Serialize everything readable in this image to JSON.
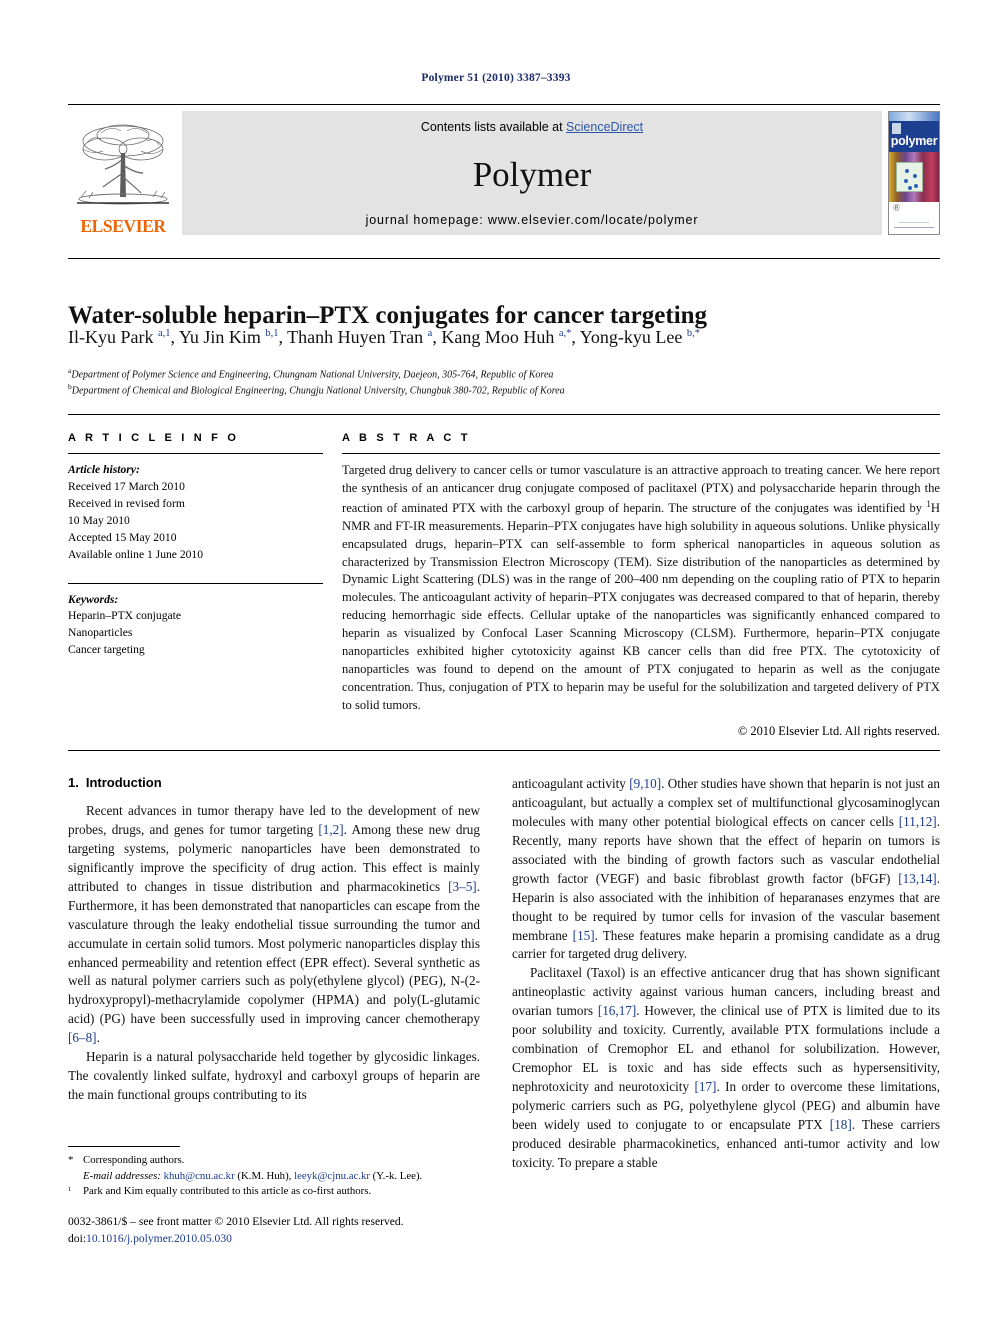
{
  "running_head": "Polymer 51 (2010) 3387–3393",
  "journal_header": {
    "contents_prefix": "Contents lists available at ",
    "sciencedirect": "ScienceDirect",
    "journal_name": "Polymer",
    "homepage": "journal homepage: www.elsevier.com/locate/polymer",
    "publisher_logo_text": "ELSEVIER",
    "cover_title": "polymer",
    "accent_color": "#2b57a8",
    "elsevier_orange": "#ec6607",
    "cover_blue": "#1c3f8f"
  },
  "article": {
    "title": "Water-soluble heparin–PTX conjugates for cancer targeting",
    "authors_html": "Il-Kyu Park <sup>a,1</sup>, Yu Jin Kim <sup>b,1</sup>, Thanh Huyen Tran <sup>a</sup>, Kang Moo Huh <sup>a,*</sup>, Yong-kyu Lee <sup>b,*</sup>",
    "affiliations": [
      "Department of Polymer Science and Engineering, Chungnam National University, Daejeon, 305-764, Republic of Korea",
      "Department of Chemical and Biological Engineering, Chungju National University, Chungbuk 380-702, Republic of Korea"
    ],
    "affiliation_marks": [
      "a",
      "b"
    ]
  },
  "article_info": {
    "heading": "A R T I C L E   I N F O",
    "history_label": "Article history:",
    "history": [
      "Received 17 March 2010",
      "Received in revised form",
      "10 May 2010",
      "Accepted 15 May 2010",
      "Available online 1 June 2010"
    ],
    "keywords_label": "Keywords:",
    "keywords": [
      "Heparin–PTX conjugate",
      "Nanoparticles",
      "Cancer targeting"
    ]
  },
  "abstract": {
    "heading": "A B S T R A C T",
    "text_part1": "Targeted drug delivery to cancer cells or tumor vasculature is an attractive approach to treating cancer. We here report the synthesis of an anticancer drug conjugate composed of paclitaxel (PTX) and polysaccharide heparin through the reaction of aminated PTX with the carboxyl group of heparin. The structure of the conjugates was identified by ",
    "superscript": "1",
    "text_part2": "H NMR and FT-IR measurements. Heparin–PTX conjugates have high solubility in aqueous solutions. Unlike physically encapsulated drugs, heparin–PTX can self-assemble to form spherical nanoparticles in aqueous solution as characterized by Transmission Electron Microscopy (TEM). Size distribution of the nanoparticles as determined by Dynamic Light Scattering (DLS) was in the range of 200–400 nm depending on the coupling ratio of PTX to heparin molecules. The anticoagulant activity of heparin–PTX conjugates was decreased compared to that of heparin, thereby reducing hemorrhagic side effects. Cellular uptake of the nanoparticles was significantly enhanced compared to heparin as visualized by Confocal Laser Scanning Microscopy (CLSM). Furthermore, heparin–PTX conjugate nanoparticles exhibited higher cytotoxicity against KB cancer cells than did free PTX. The cytotoxicity of nanoparticles was found to depend on the amount of PTX conjugated to heparin as well as the conjugate concentration. Thus, conjugation of PTX to heparin may be useful for the solubilization and targeted delivery of PTX to solid tumors.",
    "copyright": "© 2010 Elsevier Ltd. All rights reserved."
  },
  "introduction": {
    "number": "1.",
    "heading": "Introduction",
    "para1_a": "Recent advances in tumor therapy have led to the development of new probes, drugs, and genes for tumor targeting ",
    "ref1": "[1,2]",
    "para1_b": ". Among these new drug targeting systems, polymeric nanoparticles have been demonstrated to significantly improve the specificity of drug action. This effect is mainly attributed to changes in tissue distribution and pharmacokinetics ",
    "ref2": "[3–5]",
    "para1_c": ". Furthermore, it has been demonstrated that nanoparticles can escape from the vasculature through the leaky endothelial tissue surrounding the tumor and accumulate in certain solid tumors. Most polymeric nanoparticles display this enhanced permeability and retention effect (EPR effect). Several synthetic as well as natural polymer carriers such as poly(ethylene glycol) (PEG), N-(2-hydroxypropyl)-methacrylamide copolymer (HPMA) and poly(L-glutamic acid) (PG) have been successfully used in improving cancer chemotherapy ",
    "ref3": "[6–8]",
    "para1_d": ".",
    "para2_a": "Heparin is a natural polysaccharide held together by glycosidic linkages. The covalently linked sulfate, hydroxyl and carboxyl groups of heparin are the main functional groups contributing to its ",
    "para2_b": "anticoagulant activity ",
    "ref4": "[9,10]",
    "para2_c": ". Other studies have shown that heparin is not just an anticoagulant, but actually a complex set of multifunctional glycosaminoglycan molecules with many other potential biological effects on cancer cells ",
    "ref5": "[11,12]",
    "para2_d": ". Recently, many reports have shown that the effect of heparin on tumors is associated with the binding of growth factors such as vascular endothelial growth factor (VEGF) and basic fibroblast growth factor (bFGF) ",
    "ref6": "[13,14]",
    "para2_e": ". Heparin is also associated with the inhibition of heparanases enzymes that are thought to be required by tumor cells for invasion of the vascular basement membrane ",
    "ref7": "[15]",
    "para2_f": ". These features make heparin a promising candidate as a drug carrier for targeted drug delivery.",
    "para3_a": "Paclitaxel (Taxol) is an effective anticancer drug that has shown significant antineoplastic activity against various human cancers, including breast and ovarian tumors ",
    "ref8": "[16,17]",
    "para3_b": ". However, the clinical use of PTX is limited due to its poor solubility and toxicity. Currently, available PTX formulations include a combination of Cremophor EL and ethanol for solubilization. However, Cremophor EL is toxic and has side effects such as hypersensitivity, nephrotoxicity and neurotoxicity ",
    "ref9": "[17]",
    "para3_c": ". In order to overcome these limitations, polymeric carriers such as PG, polyethylene glycol (PEG) and albumin have been widely used to conjugate to or encapsulate PTX ",
    "ref10": "[18]",
    "para3_d": ". These carriers produced desirable pharmacokinetics, enhanced anti-tumor activity and low toxicity. To prepare a stable"
  },
  "footnotes": {
    "corresponding_mark": "*",
    "corresponding_text": "Corresponding authors.",
    "email_label": "E-mail addresses:",
    "email1": "khuh@cnu.ac.kr",
    "email1_owner": "(K.M. Huh),",
    "email2": "leeyk@cjnu.ac.kr",
    "email2_owner": "(Y.-k. Lee).",
    "note_mark": "1",
    "note_text": "Park and Kim equally contributed to this article as co-first authors."
  },
  "colophon": {
    "line1": "0032-3861/$ – see front matter © 2010 Elsevier Ltd. All rights reserved.",
    "doi_label": "doi:",
    "doi_value": "10.1016/j.polymer.2010.05.030"
  }
}
